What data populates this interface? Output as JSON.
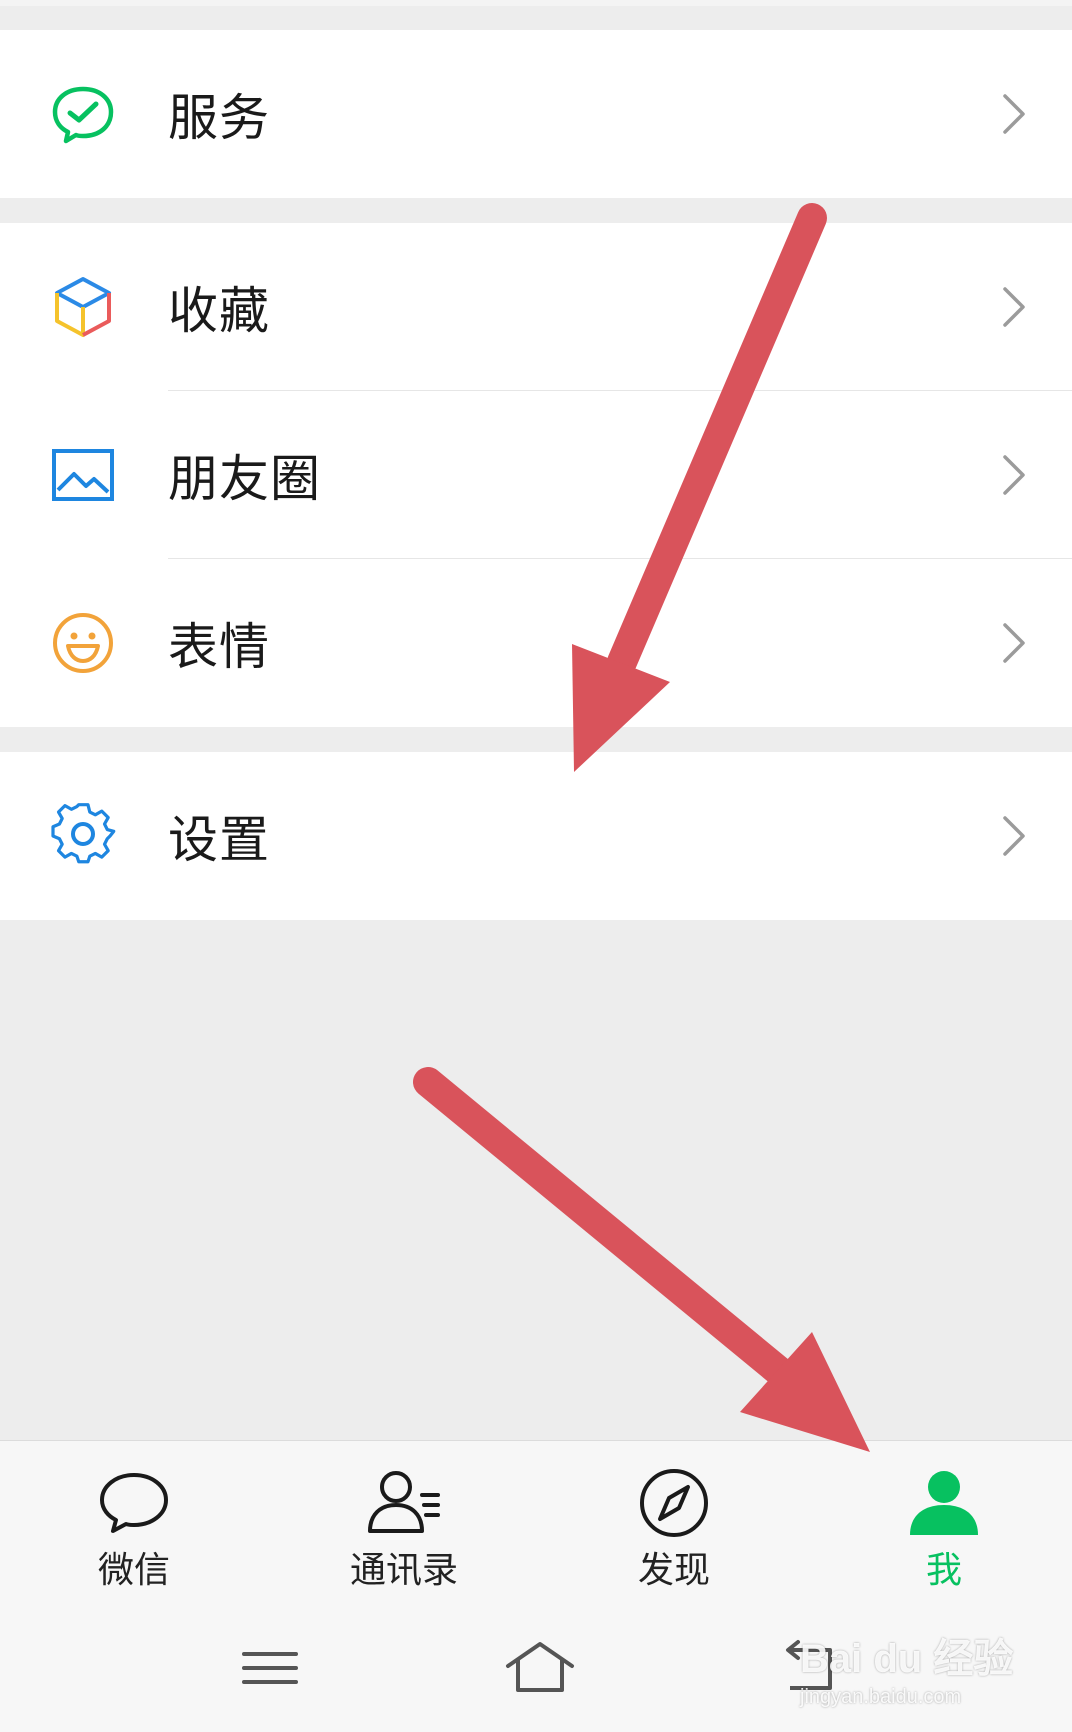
{
  "menu": {
    "services": {
      "label": "服务",
      "icon": "wechat-pay-icon"
    },
    "favorites": {
      "label": "收藏",
      "icon": "cube-icon"
    },
    "moments": {
      "label": "朋友圈",
      "icon": "image-icon"
    },
    "stickers": {
      "label": "表情",
      "icon": "smiley-icon"
    },
    "settings": {
      "label": "设置",
      "icon": "gear-icon"
    }
  },
  "tabbar": {
    "chats": "微信",
    "contacts": "通讯录",
    "discover": "发现",
    "me": "我",
    "active": "me"
  },
  "watermark": {
    "brand": "Bai du 经验",
    "url": "jingyan.baidu.com"
  },
  "colors": {
    "accent": "#07c160",
    "annotation_arrow": "#d9535b",
    "icon_blue": "#1e86e0",
    "icon_orange": "#f2a33a"
  }
}
